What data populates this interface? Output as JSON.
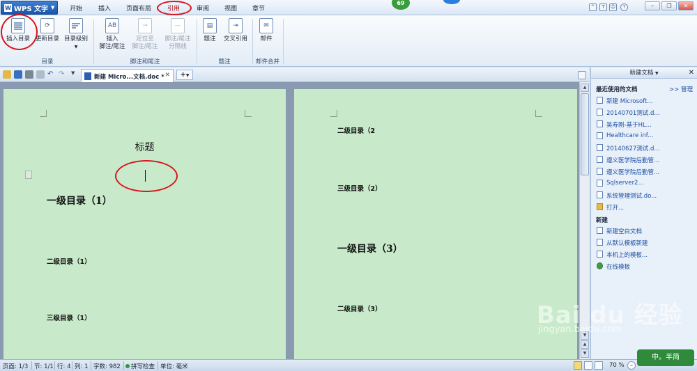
{
  "app": {
    "name": "WPS 文字",
    "logo": "W"
  },
  "menu": {
    "items": [
      "开始",
      "插入",
      "页面布局",
      "引用",
      "审阅",
      "视图",
      "章节"
    ],
    "active": "引用"
  },
  "badge": {
    "count": "69"
  },
  "window_controls": {
    "minimize": "–",
    "restore": "❐",
    "close": "✕"
  },
  "ribbon": {
    "toc": {
      "insert": "插入目录",
      "update": "更新目录",
      "level": "目录级别",
      "group": "目录"
    },
    "footnote": {
      "insert": [
        "插入",
        "脚注/尾注"
      ],
      "locate": [
        "定位至",
        "脚注/尾注"
      ],
      "separator": [
        "脚注/尾注",
        "分隔线"
      ],
      "group": "脚注和尾注"
    },
    "caption": {
      "caption": "题注",
      "crossref": "交叉引用",
      "group": "题注"
    },
    "mail": {
      "mail": "邮件",
      "group": "邮件合并"
    }
  },
  "tab": {
    "doc_title": "新建 Micro...文档.doc *",
    "new_tab": "+"
  },
  "document": {
    "page1": {
      "title": "标题",
      "h1_1": "一级目录（1）",
      "h2_1": "二级目录（1）",
      "h3_1": "三级目录（1）"
    },
    "page2": {
      "h2_2": "二级目录（2",
      "h3_2": "三级目录（2）",
      "h1_3": "一级目录（3）",
      "h2_3": "二级目录（3）"
    },
    "fill_char": "`"
  },
  "taskpane": {
    "title": "新建文档",
    "recent_header": "最近使用的文档",
    "manage": ">> 管理",
    "recent": [
      "新建 Microsoft...",
      "20140701测试.d...",
      "吴寿刚-基于HL...",
      "Healthcare inf...",
      "20140627测试.d...",
      "遵义医学院后勤管...",
      "遵义医学院后勤管...",
      "Sqlserver2...",
      "系统管理测试.do..."
    ],
    "open": "打开...",
    "new_header": "新建",
    "new_items": [
      "新建空白文档",
      "从默认模板新建",
      "本机上的模板...",
      "在线模板"
    ]
  },
  "status": {
    "page": "页面: 1/3",
    "section": "节: 1/1",
    "row": "行: 4",
    "col": "列: 1",
    "words": "字数: 982",
    "spell": "拼写检查",
    "unit": "单位: 毫米",
    "zoom": "70 %"
  },
  "watermark": {
    "brand": "Bai du 经验",
    "url": "jingyan.baidu.com"
  },
  "stamp": "中。半简"
}
